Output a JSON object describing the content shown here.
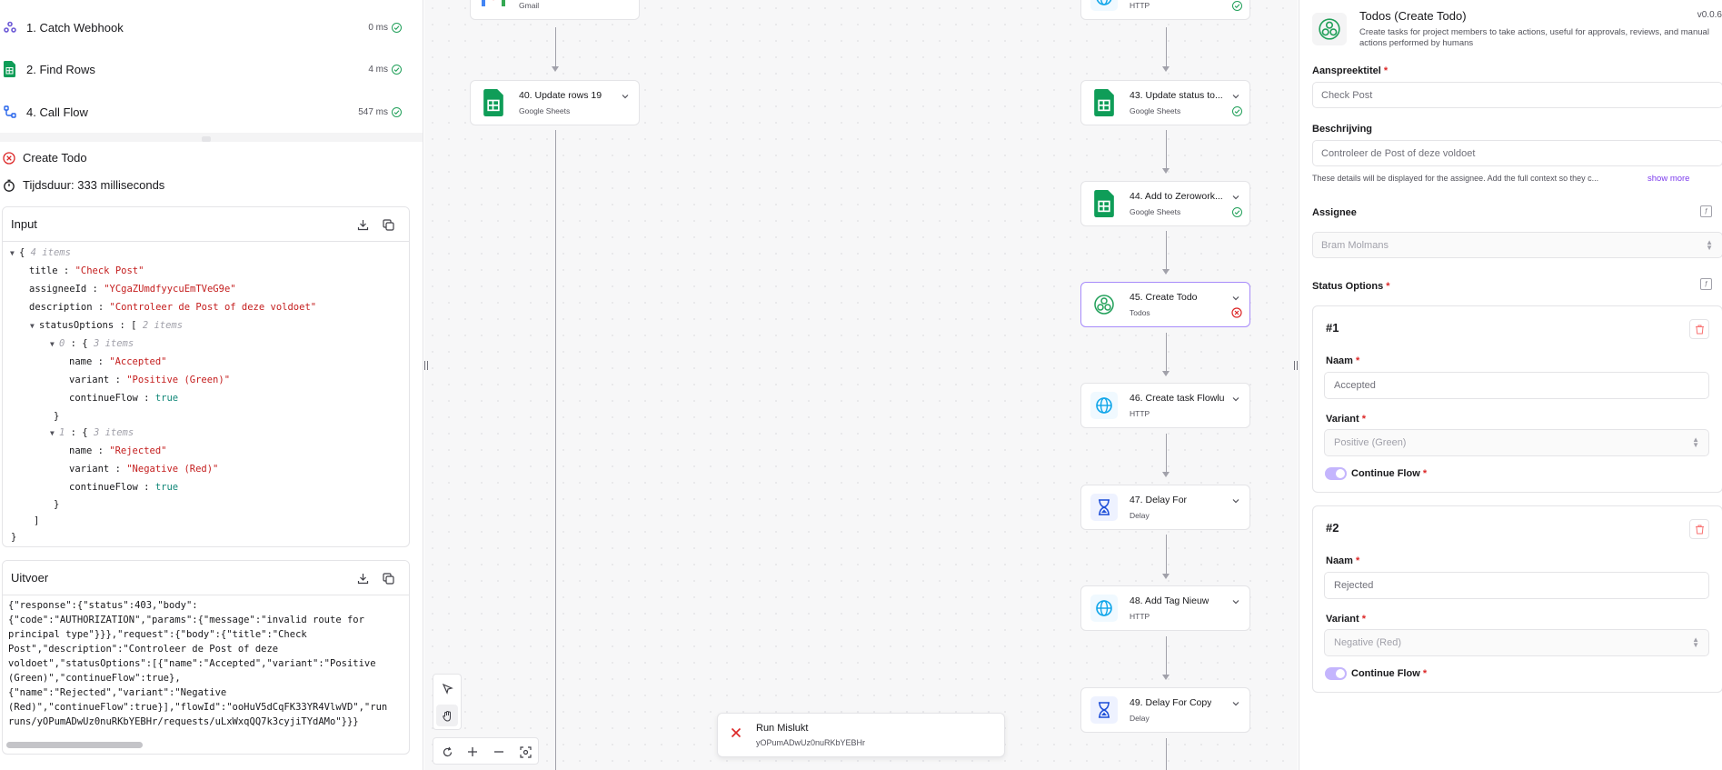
{
  "run_steps": [
    {
      "label": "1. Catch Webhook",
      "duration": "0 ms",
      "icon": "webhook-icon",
      "color": "#6d5ad6"
    },
    {
      "label": "2. Find Rows",
      "duration": "4 ms",
      "icon": "google-sheets-icon",
      "color": "#0f9d58"
    },
    {
      "label": "4. Call Flow",
      "duration": "547 ms",
      "icon": "flow-icon",
      "color": "#2563eb"
    }
  ],
  "error_step": {
    "title": "Create Todo",
    "duration": "Tijdsduur: 333 milliseconds"
  },
  "input_panel": {
    "title": "Input",
    "lines": {
      "open": "{",
      "count": "4 items",
      "title_key": "title",
      "title_val": "\"Check Post\"",
      "assignee_key": "assigneeId",
      "assignee_val": "\"YCgaZUmdfyycuEmTVeG9e\"",
      "desc_key": "description",
      "desc_val": "\"Controleer de Post of deze voldoet\"",
      "status_key": "statusOptions",
      "status_count": "2 items",
      "opt0_idx": "0",
      "opt0_count": "3 items",
      "opt0_name": "\"Accepted\"",
      "opt0_variant": "\"Positive (Green)\"",
      "opt0_flow": "true",
      "opt1_idx": "1",
      "opt1_count": "3 items",
      "opt1_name": "\"Rejected\"",
      "opt1_variant": "\"Negative (Red)\"",
      "opt1_flow": "true",
      "name_key": "name",
      "variant_key": "variant",
      "flow_key": "continueFlow",
      "close_obj": "}",
      "close_arr": "]",
      "close_root": "}",
      "open_arr": "[",
      "open_obj": "{"
    }
  },
  "output_panel": {
    "title": "Uitvoer",
    "text": "{\"response\":{\"status\":403,\"body\":\n{\"code\":\"AUTHORIZATION\",\"params\":{\"message\":\"invalid route for\nprincipal type\"}}},\"request\":{\"body\":{\"title\":\"Check\nPost\",\"description\":\"Controleer de Post of deze\nvoldoet\",\"statusOptions\":[{\"name\":\"Accepted\",\"variant\":\"Positive\n(Green)\",\"continueFlow\":true},\n{\"name\":\"Rejected\",\"variant\":\"Negative\n(Red)\",\"continueFlow\":true}],\"flowId\":\"ooHuV5dCqFK33YR4VlwVD\",\"run\nruns/yOPumADwUz0nuRKbYEBHr/requests/uLxWxqQQ7k3cyjiTYdAMo\"}}}"
  },
  "canvas": {
    "left_nodes": [
      {
        "title": "",
        "sub": "Gmail",
        "icon": "gmail-icon"
      },
      {
        "title": "40. Update rows 19",
        "sub": "Google Sheets",
        "icon": "google-sheets-icon"
      }
    ],
    "right_nodes": [
      {
        "title": "",
        "sub": "HTTP",
        "icon": "globe-icon",
        "status": "success"
      },
      {
        "title": "43. Update status to...",
        "sub": "Google Sheets",
        "icon": "google-sheets-icon",
        "status": "success"
      },
      {
        "title": "44. Add to Zerowork...",
        "sub": "Google Sheets",
        "icon": "google-sheets-icon",
        "status": "success"
      },
      {
        "title": "45. Create Todo",
        "sub": "Todos",
        "icon": "todos-icon",
        "status": "failed"
      },
      {
        "title": "46. Create task Flowlu",
        "sub": "HTTP",
        "icon": "globe-icon",
        "status": ""
      },
      {
        "title": "47. Delay For",
        "sub": "Delay",
        "icon": "hourglass-icon",
        "status": ""
      },
      {
        "title": "48. Add Tag Nieuw",
        "sub": "HTTP",
        "icon": "globe-icon",
        "status": ""
      },
      {
        "title": "49. Delay For Copy",
        "sub": "Delay",
        "icon": "hourglass-icon",
        "status": ""
      }
    ],
    "toast": {
      "title": "Run Mislukt",
      "run_id": "yOPumADwUz0nuRKbYEBHr"
    }
  },
  "settings": {
    "title": "Todos (Create Todo)",
    "version": "v0.0.6",
    "description": "Create tasks for project members to take actions, useful for approvals, reviews, and manual actions performed by humans",
    "fields": {
      "title_label": "Aanspreektitel",
      "title_value": "Check Post",
      "desc_label": "Beschrijving",
      "desc_value": "Controleer de Post of deze voldoet",
      "desc_help": "These details will be displayed for the assignee. Add the full context so they c...",
      "show_more": "show more",
      "assignee_label": "Assignee",
      "assignee_value": "Bram Molmans",
      "status_label": "Status Options"
    },
    "options": [
      {
        "num": "#1",
        "name_label": "Naam",
        "name": "Accepted",
        "variant_label": "Variant",
        "variant": "Positive (Green)",
        "flow_label": "Continue Flow"
      },
      {
        "num": "#2",
        "name_label": "Naam",
        "name": "Rejected",
        "variant_label": "Variant",
        "variant": "Negative (Red)",
        "flow_label": "Continue Flow"
      }
    ],
    "required_mark": "*"
  },
  "colors": {
    "accent": "#7c3aed",
    "success": "#22a05a",
    "error": "#dc2626",
    "sheets": "#0f9d58",
    "http": "#0ea5e9"
  }
}
